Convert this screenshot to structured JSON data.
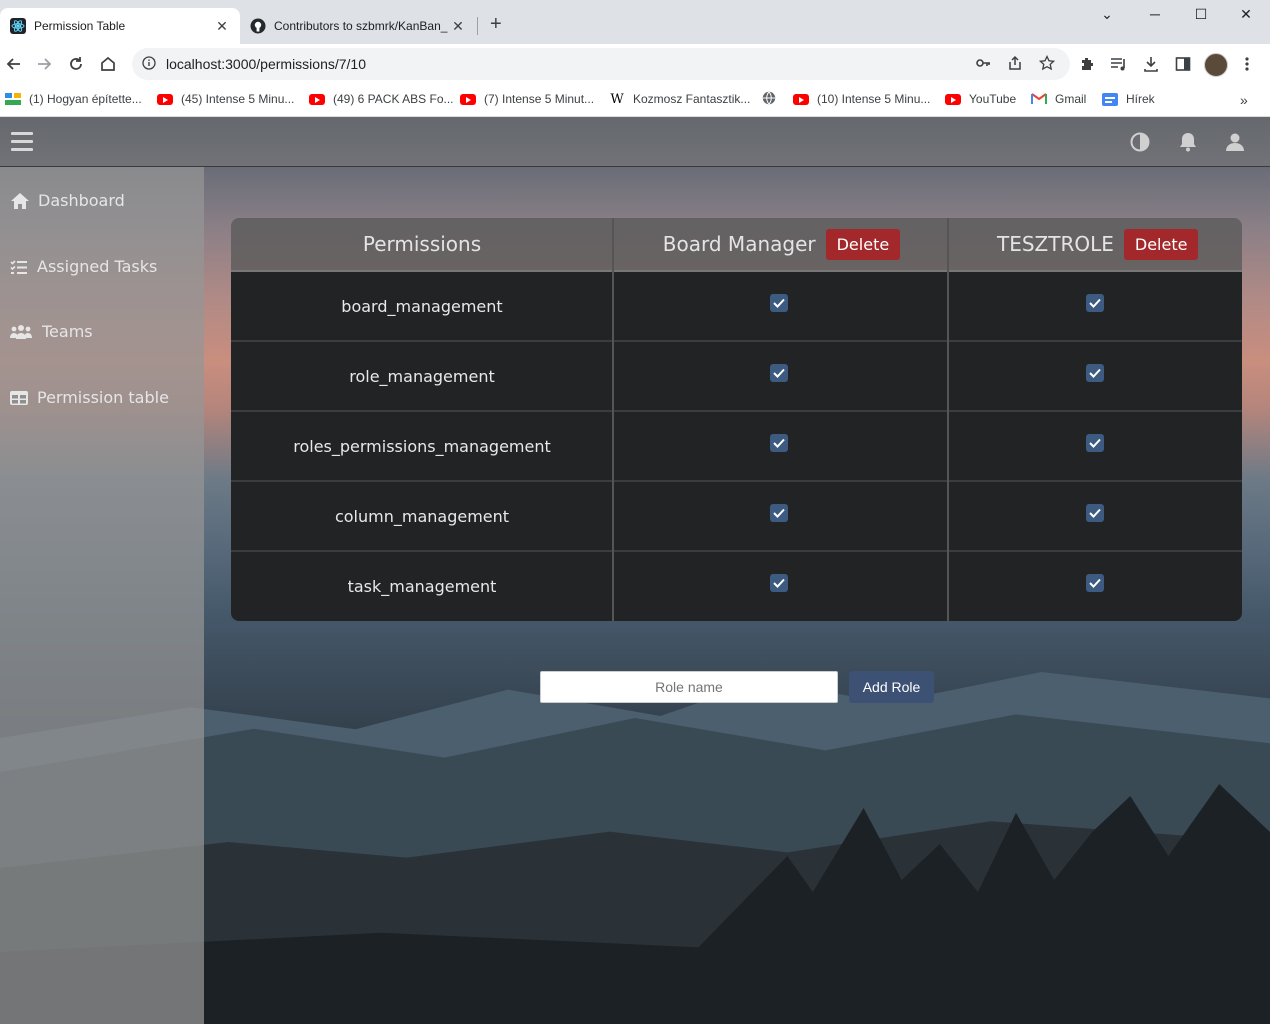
{
  "browser": {
    "tabs": [
      {
        "title": "Permission Table",
        "active": true
      },
      {
        "title": "Contributors to szbmrk/KanBan_",
        "active": false
      }
    ],
    "url": "localhost:3000/permissions/7/10",
    "bookmarks": [
      {
        "label": "(1) Hogyan építette...",
        "icon": "generic-site-icon"
      },
      {
        "label": "(45) Intense 5 Minu...",
        "icon": "youtube-icon"
      },
      {
        "label": "(49) 6 PACK ABS Fo...",
        "icon": "youtube-icon"
      },
      {
        "label": "(7) Intense 5 Minut...",
        "icon": "youtube-icon"
      },
      {
        "label": "Kozmosz Fantasztik...",
        "icon": "wikipedia-icon"
      },
      {
        "label": "",
        "icon": "globe-icon"
      },
      {
        "label": "(10) Intense 5 Minu...",
        "icon": "youtube-icon"
      },
      {
        "label": "YouTube",
        "icon": "youtube-icon"
      },
      {
        "label": "Gmail",
        "icon": "gmail-icon"
      },
      {
        "label": "Hírek",
        "icon": "google-news-icon"
      }
    ]
  },
  "sidebar": {
    "items": [
      {
        "label": "Dashboard",
        "icon": "home-icon"
      },
      {
        "label": "Assigned Tasks",
        "icon": "task-list-icon"
      },
      {
        "label": "Teams",
        "icon": "users-icon"
      },
      {
        "label": "Permission table",
        "icon": "table-icon"
      }
    ]
  },
  "table": {
    "header": "Permissions",
    "roles": [
      {
        "name": "Board Manager",
        "delete_label": "Delete"
      },
      {
        "name": "TESZTROLE",
        "delete_label": "Delete"
      }
    ],
    "permissions": [
      {
        "name": "board_management",
        "checked": [
          true,
          true
        ]
      },
      {
        "name": "role_management",
        "checked": [
          true,
          true
        ]
      },
      {
        "name": "roles_permissions_management",
        "checked": [
          true,
          true
        ]
      },
      {
        "name": "column_management",
        "checked": [
          true,
          true
        ]
      },
      {
        "name": "task_management",
        "checked": [
          true,
          true
        ]
      }
    ]
  },
  "add_role": {
    "placeholder": "Role name",
    "value": "",
    "button_label": "Add Role"
  },
  "colors": {
    "delete_button": "#a3282c",
    "add_button": "#3d5174",
    "checkbox": "#3d5a80",
    "table_body": "#222325"
  }
}
